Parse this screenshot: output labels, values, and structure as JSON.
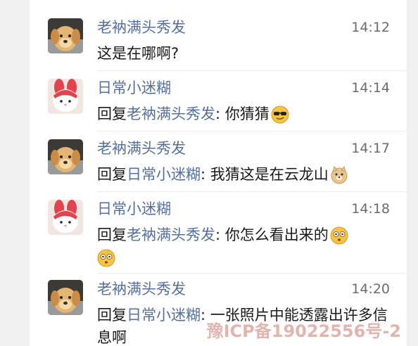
{
  "comments": [
    {
      "author": "老衲满头秀发",
      "time": "14:12",
      "text": "这是在哪啊?",
      "avatar": "dog-avatar"
    },
    {
      "author": "日常小迷糊",
      "time": "14:14",
      "reply_prefix": "回复",
      "reply_to": "老衲满头秀发",
      "reply_sep": ":",
      "text": "你猜猜",
      "avatar": "rabbit-avatar",
      "emoji": "sunglasses-face-emoji"
    },
    {
      "author": "老衲满头秀发",
      "time": "14:17",
      "reply_prefix": "回复",
      "reply_to": "日常小迷糊",
      "reply_sep": ":",
      "text": "我猜这是在云龙山",
      "avatar": "dog-avatar",
      "emoji": "doge-emoji"
    },
    {
      "author": "日常小迷糊",
      "time": "14:18",
      "reply_prefix": "回复",
      "reply_to": "老衲满头秀发",
      "reply_sep": ":",
      "text": "你怎么看出来的",
      "avatar": "rabbit-avatar",
      "emoji": "wide-eyed-face-emoji"
    },
    {
      "author": "老衲满头秀发",
      "time": "14:20",
      "reply_prefix": "回复",
      "reply_to": "日常小迷糊",
      "reply_sep": ":",
      "text": "一张照片中能透露出许多信息啊",
      "avatar": "dog-avatar"
    }
  ],
  "watermark": "豫ICP备19022556号-2",
  "colors": {
    "name": "#56709b",
    "text": "#1a1a1a",
    "time": "#6b6b6b",
    "background": "#ffffff"
  }
}
